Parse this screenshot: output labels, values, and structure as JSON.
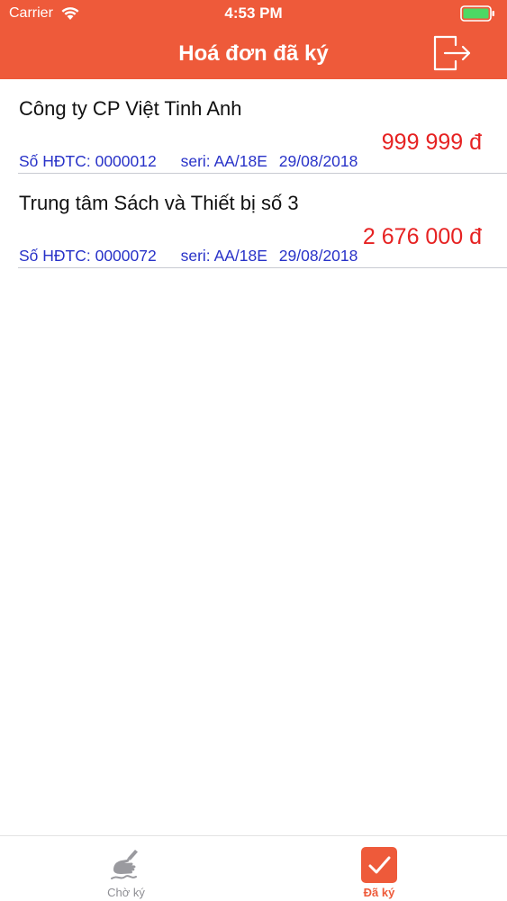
{
  "status_bar": {
    "carrier": "Carrier",
    "time": "4:53 PM"
  },
  "header": {
    "title": "Hoá đơn đã ký",
    "logout_icon": "logout-icon",
    "background_color": "#ee5a3a"
  },
  "invoices": [
    {
      "company": "Công ty CP Việt Tinh Anh",
      "amount": "999 999 đ",
      "number": "Số HĐTC: 0000012",
      "seri": "seri: AA/18E",
      "date": "29/08/2018"
    },
    {
      "company": "Trung tâm Sách và Thiết bị số 3",
      "amount": "2 676 000 đ",
      "number": "Số HĐTC: 0000072",
      "seri": "seri: AA/18E",
      "date": "29/08/2018"
    }
  ],
  "tabs": [
    {
      "label": "Chờ ký",
      "icon": "signing-hand-icon",
      "selected": false
    },
    {
      "label": "Đã ký",
      "icon": "checkmark-icon",
      "selected": true
    }
  ],
  "colors": {
    "accent": "#ee5a3a",
    "amount": "#e62222",
    "meta": "#2832c8",
    "tab_inactive": "#8e8e93"
  }
}
